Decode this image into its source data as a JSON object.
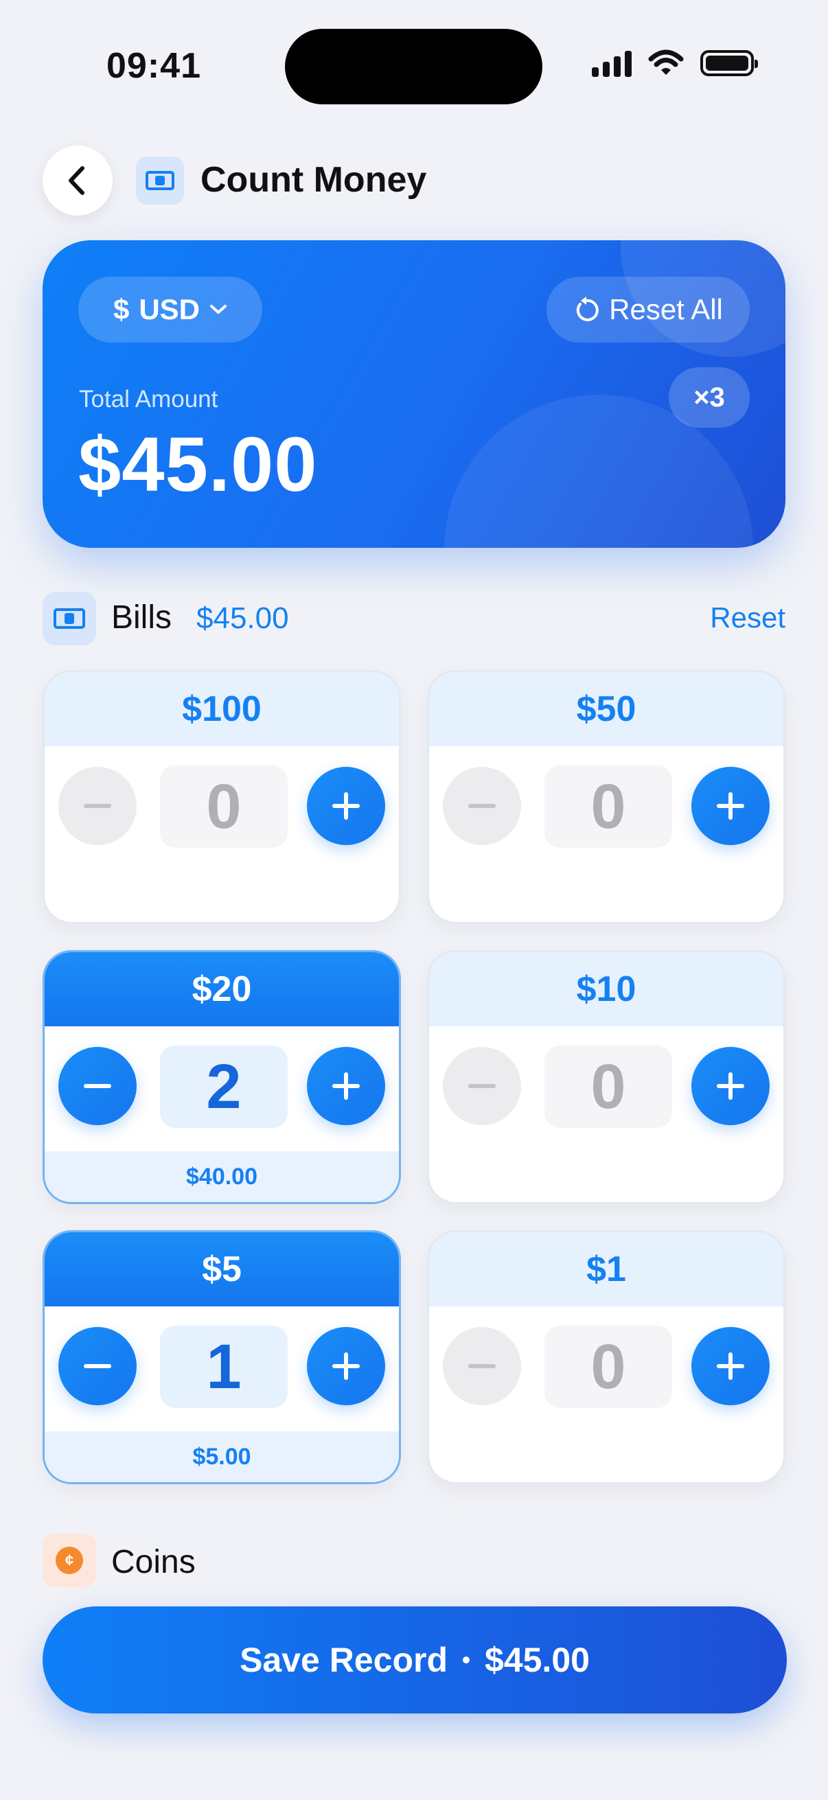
{
  "status": {
    "time": "09:41"
  },
  "header": {
    "title": "Count Money"
  },
  "summary": {
    "currency": "USD",
    "currency_symbol": "$",
    "reset_all_label": "Reset All",
    "total_label": "Total Amount",
    "total_value": "$45.00",
    "multiplier": "×3"
  },
  "bills": {
    "title": "Bills",
    "total": "$45.00",
    "reset_label": "Reset",
    "items": [
      {
        "label": "$100",
        "count": "0",
        "subtotal": ""
      },
      {
        "label": "$50",
        "count": "0",
        "subtotal": ""
      },
      {
        "label": "$20",
        "count": "2",
        "subtotal": "$40.00"
      },
      {
        "label": "$10",
        "count": "0",
        "subtotal": ""
      },
      {
        "label": "$5",
        "count": "1",
        "subtotal": "$5.00"
      },
      {
        "label": "$1",
        "count": "0",
        "subtotal": ""
      }
    ]
  },
  "coins": {
    "title": "Coins",
    "icon_glyph": "¢"
  },
  "save": {
    "label": "Save Record",
    "amount": "$45.00"
  },
  "colors": {
    "accent": "#1580f2",
    "accent_dark": "#1d4fd6",
    "background": "#f1f2f7"
  }
}
